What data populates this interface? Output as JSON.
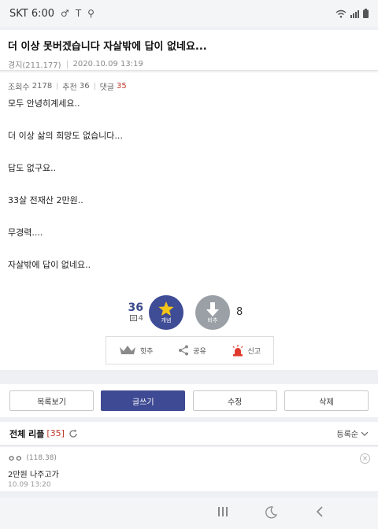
{
  "status_bar": {
    "carrier_time": "SKT 6:00",
    "left_icons": [
      "gender-icon",
      "tesla-icon",
      "usb-icon"
    ],
    "right_icons": [
      "wifi-icon",
      "signal-icon",
      "battery-icon"
    ]
  },
  "post": {
    "title": "더 이상 못버겠습니다 자살밖에 답이 없네요...",
    "author": "경지(211.177)",
    "datetime": "2020.10.09 13:19",
    "views_label": "조회수",
    "views": "2178",
    "recommend_label": "추천",
    "recommend": "36",
    "comments_label": "댓글",
    "comments": "35",
    "paragraphs": [
      "모두 안녕히계세요..",
      "더 이상 삶의 희망도 없습니다...",
      "답도 없구요..",
      "33살 전재산 2만원..",
      "무경력....",
      "자살밖에 답이 없네요.."
    ]
  },
  "vote": {
    "up_count": "36",
    "fixed_count": "4",
    "up_label": "개념",
    "down_label": "비추",
    "down_count": "8"
  },
  "actions": {
    "first_label": "힛추",
    "share_label": "공유",
    "report_label": "신고"
  },
  "board_buttons": {
    "list_label": "목록보기",
    "write_label": "글쓰기",
    "edit_label": "수정",
    "delete_label": "삭제"
  },
  "replies": {
    "title": "전체 리플",
    "count": "[35]",
    "sort_label": "등록순",
    "items": [
      {
        "author": "ㅇㅇ",
        "ip": "(118.38)",
        "text": "2만원 나주고가",
        "date": "10.09 13:20"
      }
    ]
  },
  "colors": {
    "accent": "#3e4a93",
    "alert": "#c0392b",
    "background": "#eef0f3"
  }
}
